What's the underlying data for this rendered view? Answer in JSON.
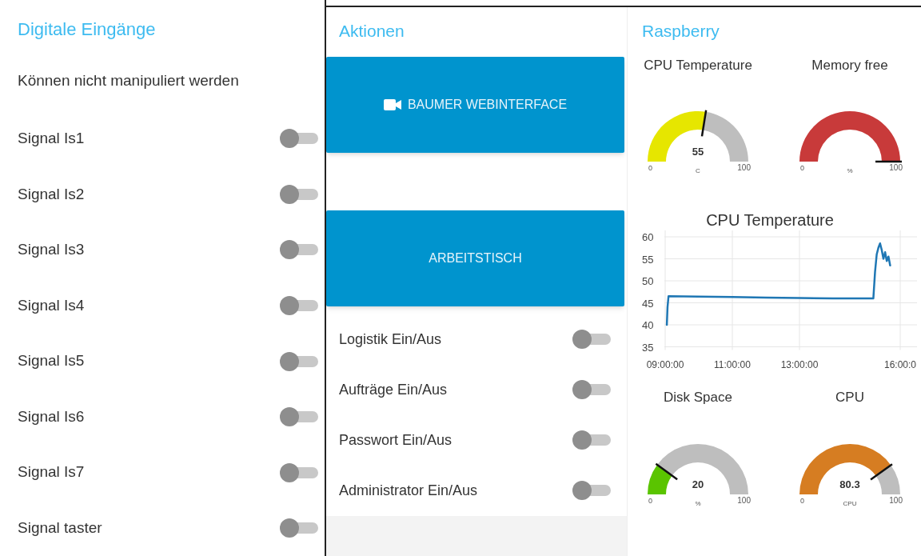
{
  "inputs": {
    "title": "Digitale Eingänge",
    "subtitle": "Können nicht manipuliert werden",
    "signals": [
      {
        "label": "Signal Is1",
        "on": false
      },
      {
        "label": "Signal Is2",
        "on": false
      },
      {
        "label": "Signal Is3",
        "on": false
      },
      {
        "label": "Signal Is4",
        "on": false
      },
      {
        "label": "Signal Is5",
        "on": false
      },
      {
        "label": "Signal Is6",
        "on": false
      },
      {
        "label": "Signal Is7",
        "on": false
      },
      {
        "label": "Signal taster",
        "on": false
      }
    ]
  },
  "actions": {
    "title": "Aktionen",
    "buttons": [
      {
        "label": "BAUMER WEBINTERFACE",
        "kind": "camera"
      },
      {
        "label": "ARBEITSTISCH",
        "kind": "plain"
      }
    ],
    "switches": [
      {
        "label": "Logistik Ein/Aus",
        "on": false
      },
      {
        "label": "Aufträge Ein/Aus",
        "on": false
      },
      {
        "label": "Passwort Ein/Aus",
        "on": false
      },
      {
        "label": "Administrator Ein/Aus",
        "on": false
      }
    ]
  },
  "raspberry": {
    "title": "Raspberry",
    "gauges_top": [
      {
        "title": "CPU Temperature",
        "value": "55",
        "unit": "C",
        "min": "0",
        "max": "100",
        "color": "#e6e600"
      },
      {
        "title": "Memory free",
        "unit": "%",
        "min": "0",
        "max": "100",
        "color": "#c83a3a"
      }
    ],
    "chart": {
      "chart_data": {
        "type": "line",
        "title": "CPU Temperature",
        "x": [
          9.05,
          9.07,
          9.1,
          10,
          11,
          12,
          13,
          14,
          15,
          15.2,
          15.25,
          15.3,
          15.35,
          15.4,
          15.45,
          15.5,
          15.55,
          15.6,
          15.65,
          15.7
        ],
        "series": [
          {
            "color": "#1f77b4",
            "values": [
              40,
              44,
              46.5,
              46.4,
              46.3,
              46.2,
              46.1,
              46,
              46,
              46,
              52,
              56,
              57.5,
              58.5,
              57,
              55,
              56.5,
              54.5,
              55.5,
              53.5
            ]
          }
        ],
        "xlim": [
          9,
          16.5
        ],
        "ylim": [
          35,
          61
        ],
        "grid": true,
        "xticks": [
          {
            "value": 9,
            "label": "09:00:00"
          },
          {
            "value": 11,
            "label": "11:00:00"
          },
          {
            "value": 13,
            "label": "13:00:00"
          },
          {
            "value": 16,
            "label": "16:00:0"
          }
        ],
        "yticks": [
          35,
          40,
          45,
          50,
          55,
          60
        ]
      }
    },
    "gauges_bottom": [
      {
        "title": "Disk Space",
        "value": "20",
        "unit": "%",
        "min": "0",
        "max": "100",
        "color": "#5ac400"
      },
      {
        "title": "CPU",
        "value": "80.3",
        "unit": "CPU",
        "min": "0",
        "max": "100",
        "color": "#d67d22"
      }
    ]
  }
}
